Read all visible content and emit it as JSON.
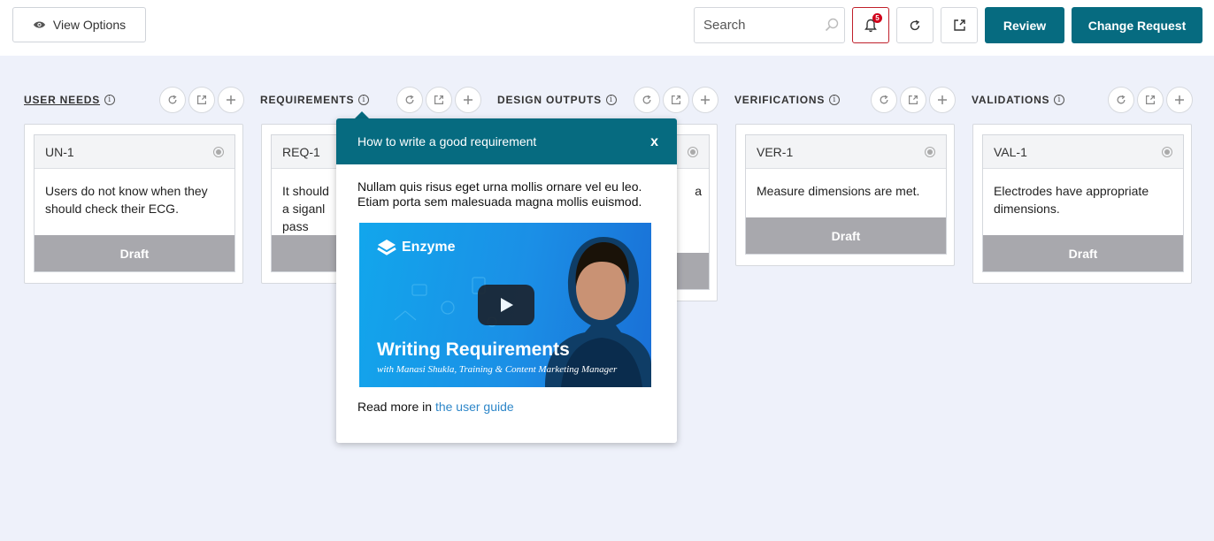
{
  "toolbar": {
    "view_options": "View Options",
    "search_placeholder": "Search",
    "notification_count": "5",
    "review": "Review",
    "change_request": "Change Request",
    "accent": "#066b80"
  },
  "columns": [
    {
      "title": "USER NEEDS",
      "card": {
        "id": "UN-1",
        "text": "Users do not know when they should check their ECG.",
        "status": "Draft"
      }
    },
    {
      "title": "REQUIREMENTS",
      "card": {
        "id": "REQ-1",
        "text": "It should a siganl pass",
        "status": "Draft"
      }
    },
    {
      "title": "DESIGN OUTPUTS",
      "card": {
        "id": "",
        "text": "a",
        "status": ""
      }
    },
    {
      "title": "VERIFICATIONS",
      "card": {
        "id": "VER-1",
        "text": "Measure dimensions are met.",
        "status": "Draft"
      }
    },
    {
      "title": "VALIDATIONS",
      "card": {
        "id": "VAL-1",
        "text": "Electrodes have appropriate dimensions.",
        "status": "Draft"
      }
    }
  ],
  "popover": {
    "title": "How to write a good requirement",
    "close": "x",
    "body": "Nullam quis risus eget urna mollis ornare vel eu leo. Etiam porta sem malesuada magna mollis euismod.",
    "video": {
      "brand": "Enzyme",
      "title": "Writing Requirements",
      "subtitle": "with Manasi Shukla, Training & Content Marketing Manager"
    },
    "read_more": "Read more in",
    "link": "the user guide"
  }
}
